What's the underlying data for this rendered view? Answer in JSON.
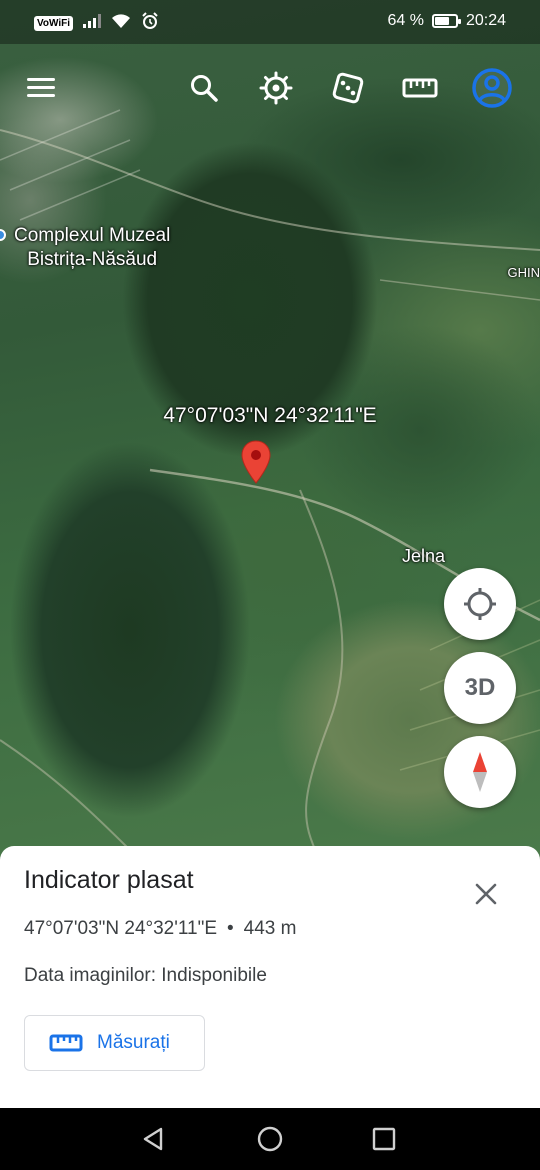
{
  "status_bar": {
    "vowifi": "VoWiFi",
    "battery": "64 %",
    "battery_level": 0.64,
    "time": "20:24"
  },
  "toolbar": {
    "icons": [
      "menu-icon",
      "search-icon",
      "voyager-icon",
      "dice-icon",
      "ruler-icon",
      "account-icon"
    ]
  },
  "map": {
    "poi_name": "Complexul Muzeal\nBistrița-Năsăud",
    "marker_coordinates": "47°07'03\"N 24°32'11\"E",
    "place_label": "Jelna",
    "edge_label": "GHIN"
  },
  "fabs": {
    "three_d_label": "3D",
    "icons": [
      "my-location-icon",
      "compass-icon"
    ]
  },
  "sheet": {
    "title": "Indicator plasat",
    "coordinates": "47°07'03\"N 24°32'11\"E",
    "separator": "•",
    "elevation": "443 m",
    "imagery_date": "Data imaginilor: Indisponibile",
    "measure_label": "Măsurați"
  },
  "colors": {
    "accent": "#1a73e8",
    "pin": "#ea4335",
    "sheet_text": "#202124"
  }
}
